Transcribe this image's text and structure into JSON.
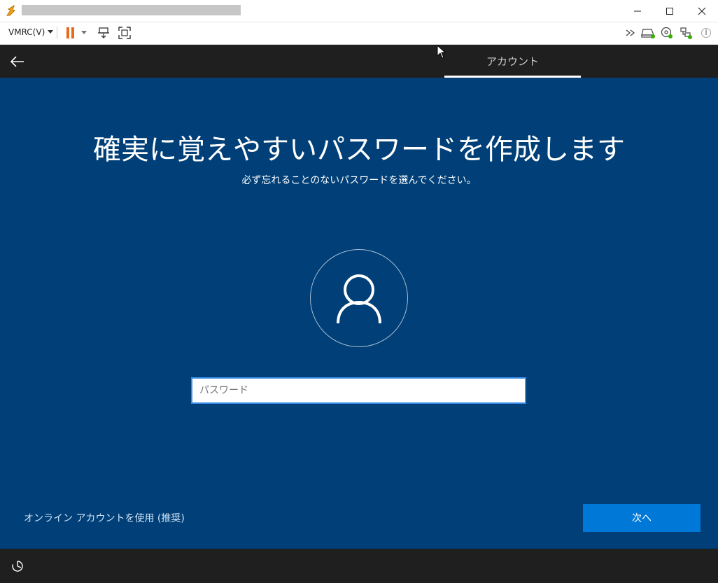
{
  "toolbar": {
    "vmrc_label": "VMRC(V)"
  },
  "oobe": {
    "tab_label": "アカウント",
    "title": "確実に覚えやすいパスワードを作成します",
    "subtitle": "必ず忘れることのないパスワードを選んでください。",
    "password_placeholder": "パスワード",
    "password_value": "",
    "online_account_link": "オンライン アカウントを使用 (推奨)",
    "next_button": "次へ"
  },
  "colors": {
    "oobe_background": "#003f77",
    "bar_background": "#1f1f1f",
    "accent_button": "#0078d7",
    "pause_orange": "#e86a1f"
  },
  "icons": {
    "app": "vmware-app-icon",
    "pause": "pause-icon",
    "dropdown": "chevron-down-icon",
    "send_keys": "send-ctrl-alt-del-icon",
    "fullscreen": "fullscreen-icon",
    "more": "double-chevron-right-icon",
    "hdd": "hard-disk-icon",
    "cd": "cd-rom-icon",
    "network": "network-adapter-icon",
    "usb": "usb-icon",
    "back": "arrow-left-icon",
    "avatar": "user-icon",
    "ease_of_access": "ease-of-access-icon"
  }
}
